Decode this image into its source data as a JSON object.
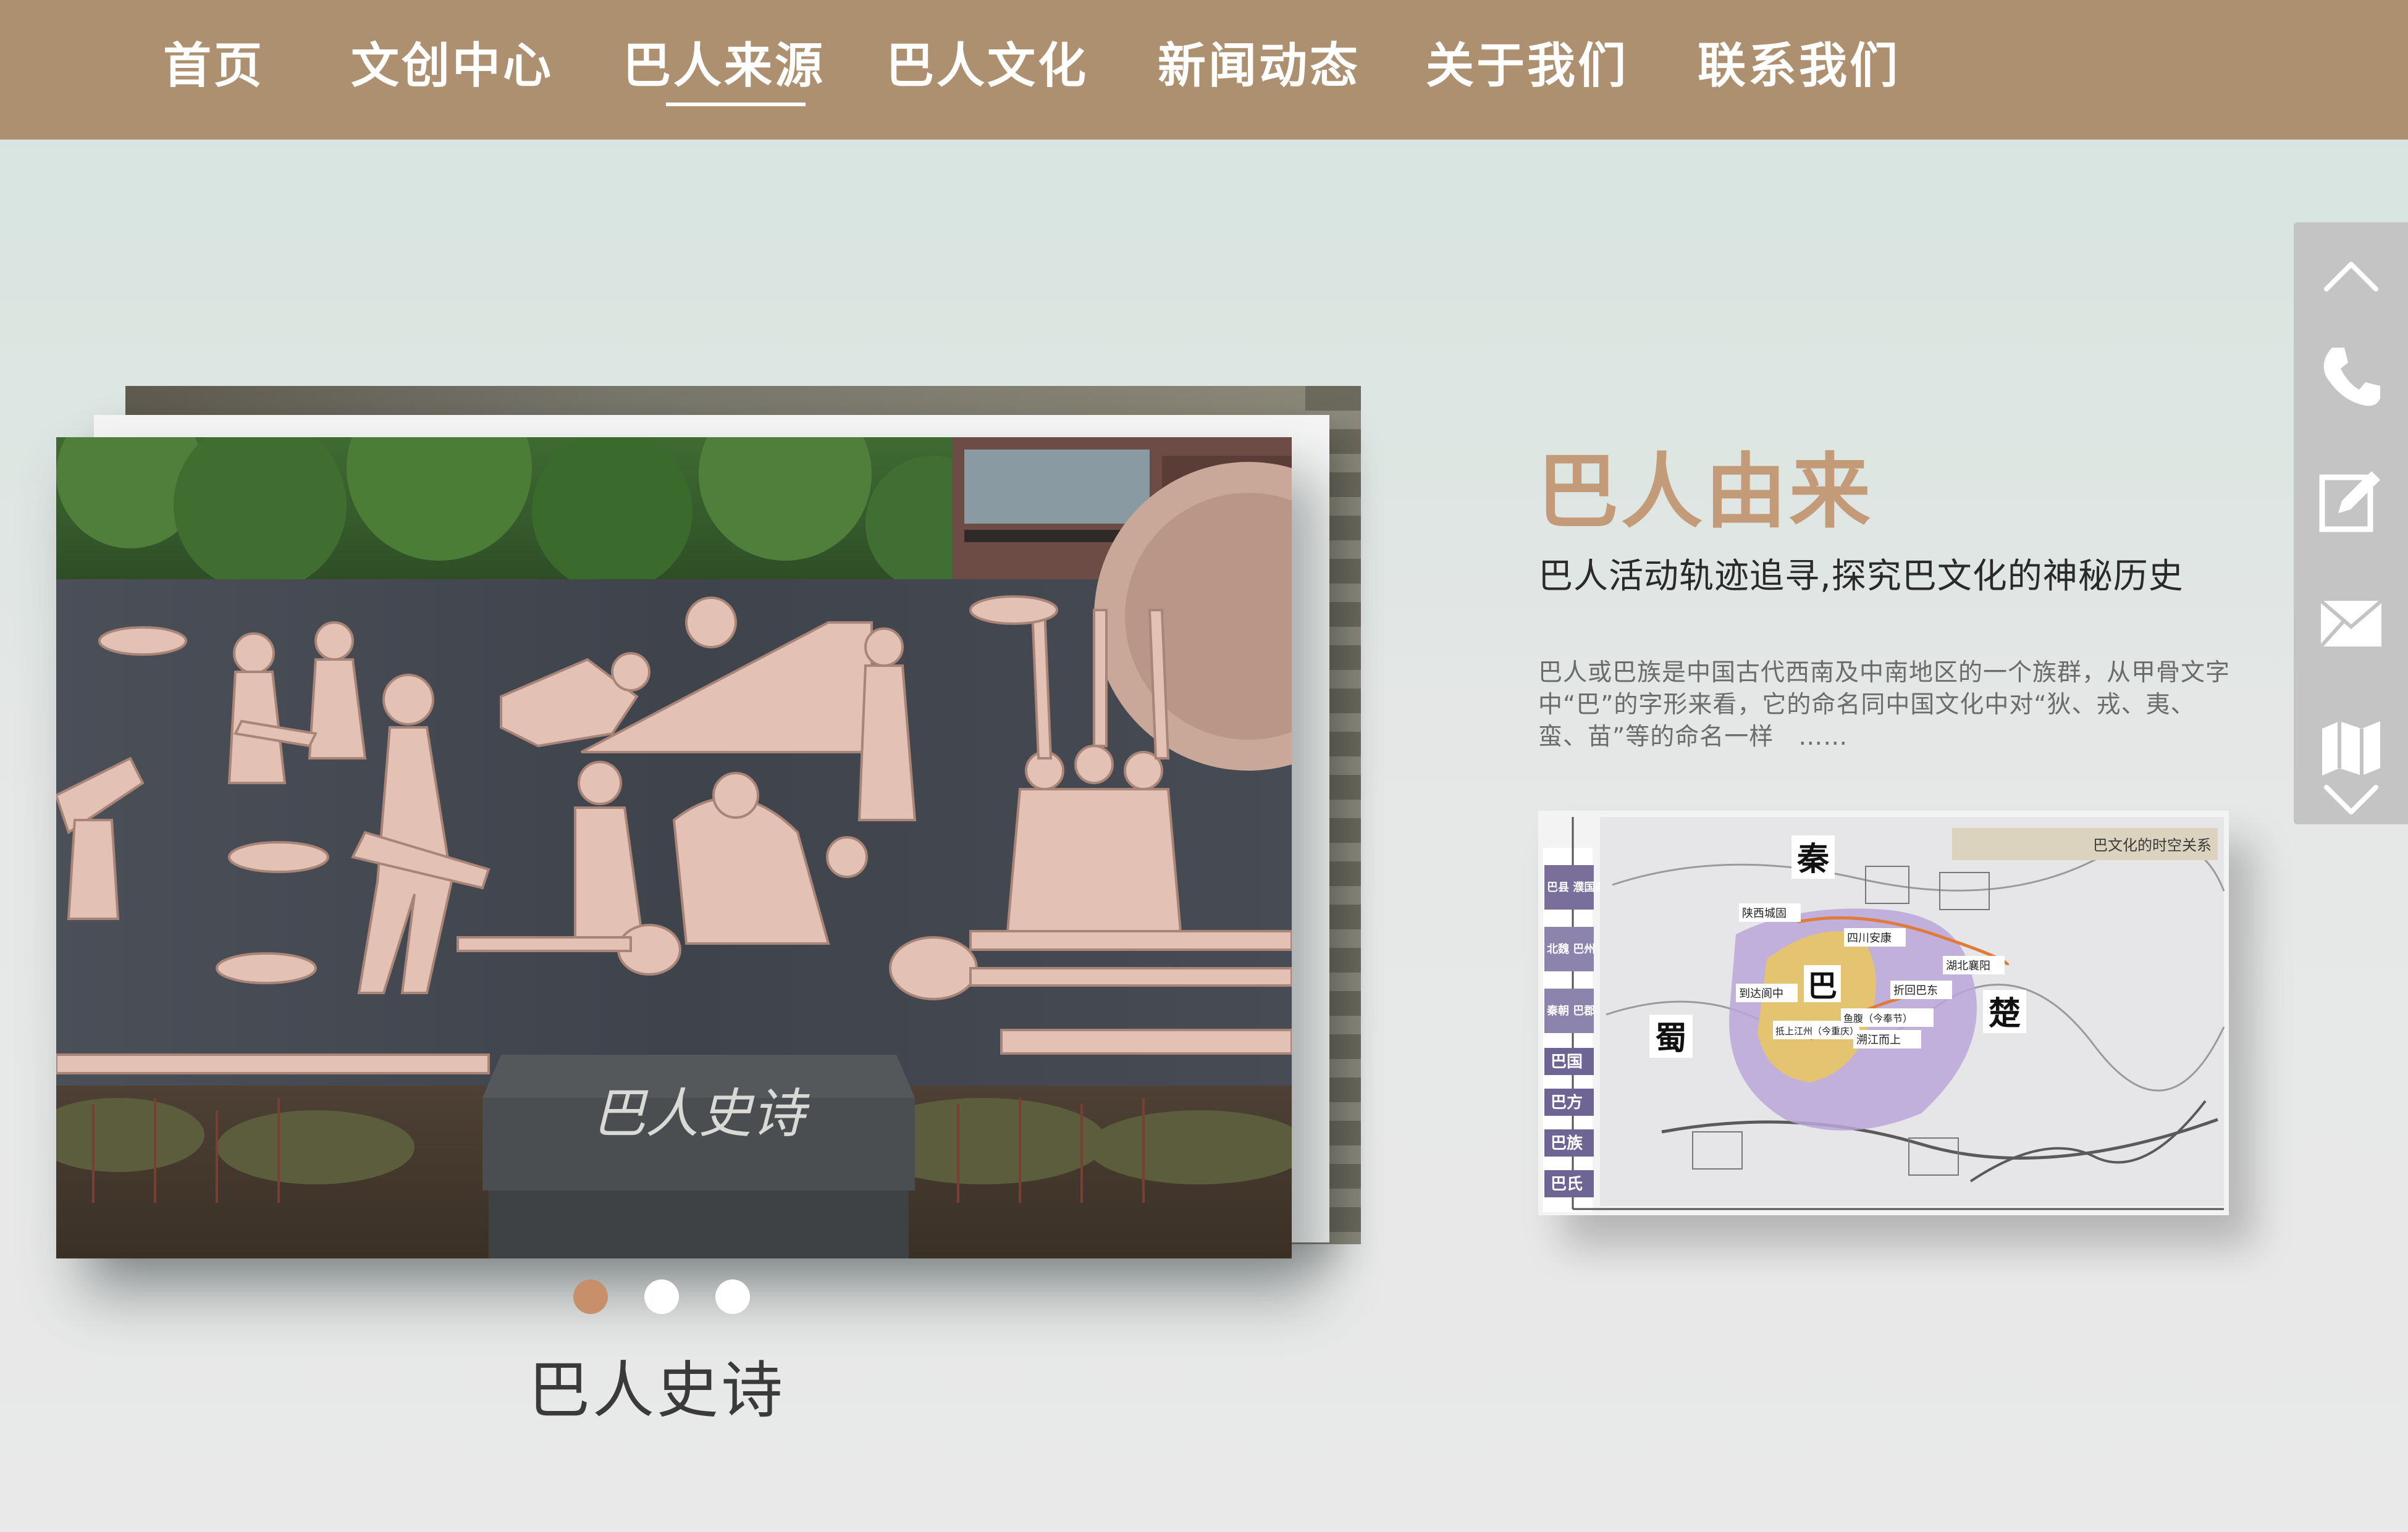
{
  "nav": {
    "items": [
      {
        "label": "首页"
      },
      {
        "label": "文创中心"
      },
      {
        "label": "巴人来源"
      },
      {
        "label": "巴人文化"
      },
      {
        "label": "新闻动态"
      },
      {
        "label": "关于我们"
      },
      {
        "label": "联系我们"
      }
    ],
    "active_index": 2
  },
  "carousel": {
    "caption": "巴人史诗",
    "slide_count": 3,
    "active_slide": 0,
    "photo": {
      "stone_sign_text": "巴人史诗"
    }
  },
  "intro": {
    "title": "巴人由来",
    "subtitle": "巴人活动轨迹追寻,探究巴文化的神秘历史",
    "body": "巴人或巴族是中国古代西南及中南地区的一个族群，从甲骨文字中“巴”的字形来看，它的命名同中国文化中对“狄、戎、夷、蛮、苗”等的命名一样　……"
  },
  "map": {
    "legend_title": "巴文化的时空关系",
    "side_labels": [
      "巴县 濮国府",
      "北魏 巴州",
      "秦朝 巴郡",
      "巴国",
      "巴方",
      "巴族",
      "巴氏"
    ],
    "regions": {
      "qin": "秦",
      "ba": "巴",
      "shu": "蜀",
      "chu": "楚"
    },
    "places": [
      "陕西城固",
      "四川安康",
      "湖北襄阳",
      "折回巴东",
      "到达阆中",
      "抵上江州（今重庆）",
      "鱼腹（今奉节）",
      "溯江而上"
    ]
  },
  "toolbar": {
    "icons": [
      "chevron-up-icon",
      "phone-icon",
      "edit-icon",
      "mail-icon",
      "map-icon",
      "chevron-down-icon"
    ]
  },
  "colors": {
    "nav_bg": "#ad9070",
    "accent_title": "#c49b78",
    "dot_active": "#c8906a",
    "toolbar_bg": "#c4c4c4"
  }
}
